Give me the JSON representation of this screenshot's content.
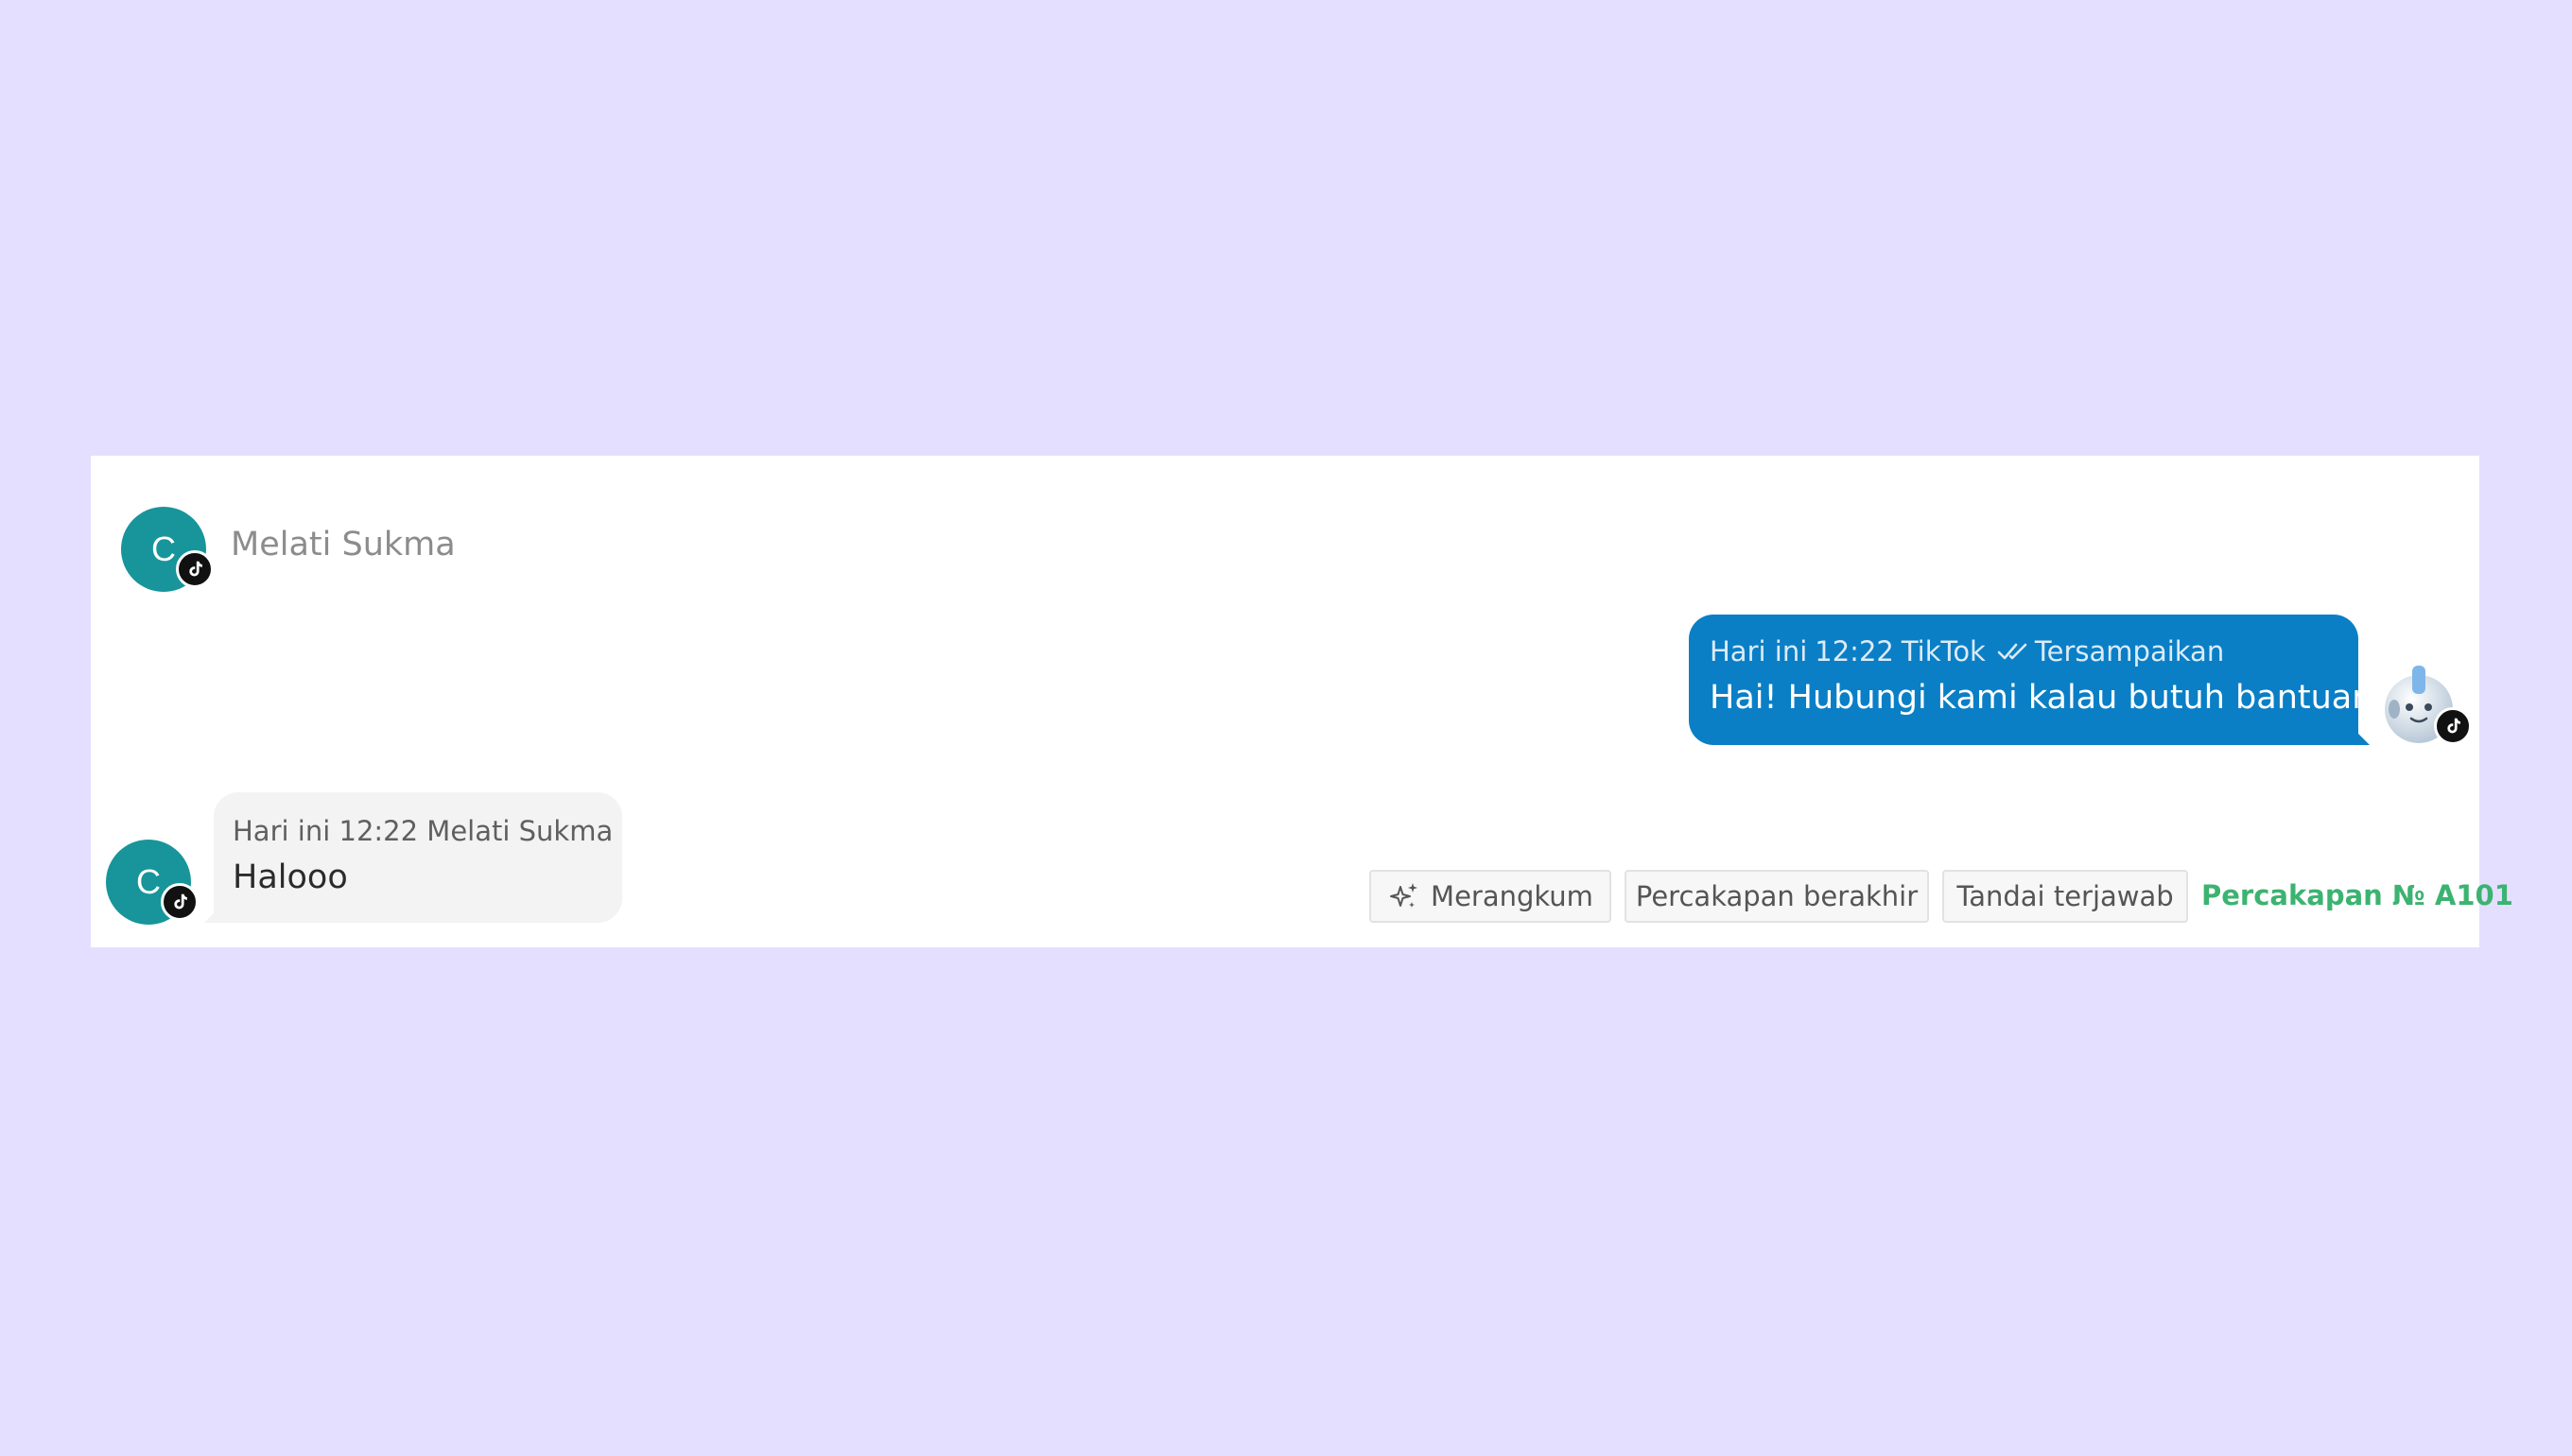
{
  "header": {
    "avatar_letter": "C",
    "contact_name": "Melati Sukma"
  },
  "outgoing_message": {
    "day": "Hari ini",
    "time": "12:22",
    "channel": "TikTok",
    "status": "Tersampaikan",
    "text": "Hai! Hubungi kami kalau butuh bantuan :)"
  },
  "incoming_message": {
    "avatar_letter": "C",
    "day": "Hari ini",
    "time": "12:22",
    "sender": "Melati Sukma",
    "text": "Halooo"
  },
  "actions": {
    "summarize_label": "Merangkum",
    "end_conversation_label": "Percakapan berakhir",
    "mark_answered_label": "Tandai terjawab",
    "conversation_number": "Percakapan № A101"
  },
  "colors": {
    "page_background": "#e4dfff",
    "avatar": "#17959a",
    "outgoing_bubble": "#0a7fc6",
    "incoming_bubble": "#f3f3f3",
    "conversation_number": "#3cb371"
  },
  "icons": {
    "channel_badge": "tiktok-icon",
    "status": "double-check-icon",
    "summarize": "sparkle-icon",
    "bot": "robot-icon"
  }
}
